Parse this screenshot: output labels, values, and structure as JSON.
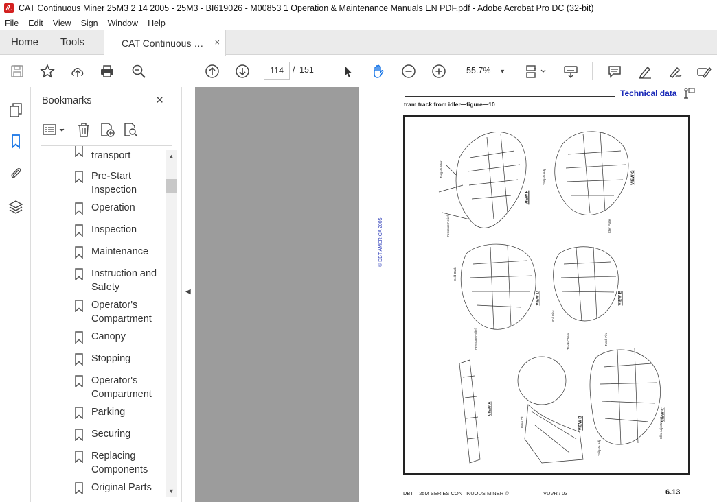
{
  "window": {
    "title": "CAT Continuous Miner 25M3 2 14 2005 - 25M3 - BI619026 - M00853 1 Operation & Maintenance Manuals EN PDF.pdf - Adobe Acrobat Pro DC (32-bit)"
  },
  "menu": [
    "File",
    "Edit",
    "View",
    "Sign",
    "Window",
    "Help"
  ],
  "tabs": {
    "home": "Home",
    "tools": "Tools",
    "document": "CAT Continuous Miner 25M3 2 14 2005 - 25M3 - BI619026 - M00853 1 Operation & Maintenance Manuals EN PDF.pdf",
    "document_short": "CAT Continuous Mi...",
    "close": "×"
  },
  "toolbar": {
    "current_page": "114",
    "separator": "/",
    "total_pages": "151",
    "zoom": "55.7%"
  },
  "bookmarks_panel": {
    "title": "Bookmarks",
    "close": "×",
    "items": [
      {
        "label": "transport"
      },
      {
        "label": "Pre-Start Inspection"
      },
      {
        "label": "Operation"
      },
      {
        "label": "Inspection"
      },
      {
        "label": "Maintenance"
      },
      {
        "label": "Instruction and Safety"
      },
      {
        "label": "Operator's Compartment"
      },
      {
        "label": "Canopy"
      },
      {
        "label": "Stopping"
      },
      {
        "label": "Operator's Compartment"
      },
      {
        "label": "Parking"
      },
      {
        "label": "Securing"
      },
      {
        "label": "Replacing Components"
      },
      {
        "label": "Original Parts"
      }
    ]
  },
  "pdf_page": {
    "header": "Technical data",
    "figure_title": "tram track from idler—figure—10",
    "copyright": "© DBT AMERICA 2005",
    "footer_left": "DBT – 25M SERIES CONTINUOUS MINER ©",
    "footer_mid": "VUVR / 03",
    "page_number": "6.13",
    "view_labels": [
      "VIEW F",
      "VIEW G",
      "VIEW D",
      "VIEW E",
      "VIEW A",
      "VIEW B",
      "VIEW C"
    ]
  }
}
